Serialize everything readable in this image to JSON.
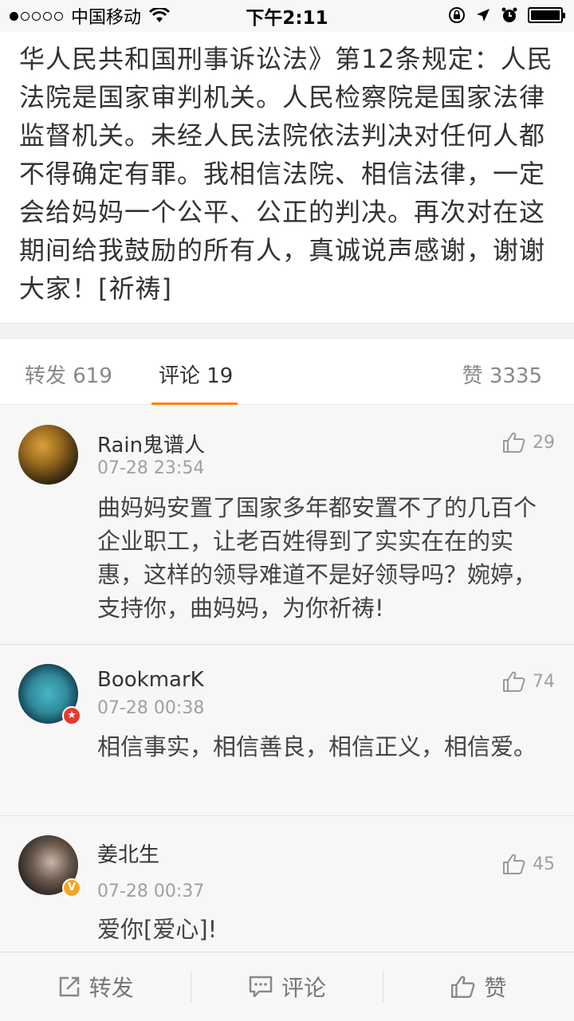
{
  "status_bar": {
    "carrier": "中国移动",
    "time": "下午2:11"
  },
  "post": {
    "text": "华人民共和国刑事诉讼法》第12条规定：人民法院是国家审判机关。人民检察院是国家法律监督机关。未经人民法院依法判决对任何人都不得确定有罪。我相信法院、相信法律，一定会给妈妈一个公平、公正的判决。再次对在这期间给我鼓励的所有人，真诚说声感谢，谢谢大家！[祈祷]"
  },
  "tabs": {
    "repost": "转发 619",
    "comments": "评论 19",
    "likes": "赞 3335"
  },
  "comments": [
    {
      "name": "Rain鬼谱人",
      "time": "07-28 23:54",
      "likes": "29",
      "text": "曲妈妈安置了国家多年都安置不了的几百个企业职工，让老百姓得到了实实在在的实惠，这样的领导难道不是好领导吗？婉婷，支持你，曲妈妈，为你祈祷!"
    },
    {
      "name": "BookmarK",
      "time": "07-28 00:38",
      "likes": "74",
      "text": "相信事实，相信善良，相信正义，相信爱。"
    },
    {
      "name": "姜北生",
      "time": "07-28 00:37",
      "likes": "45",
      "text": "爱你[爱心]!"
    }
  ],
  "bottom_bar": {
    "repost": "转发",
    "comment": "评论",
    "like": "赞"
  },
  "colors": {
    "accent": "#ff8200",
    "verified_red": "#e8382d",
    "verified_gold": "#f5a623"
  }
}
